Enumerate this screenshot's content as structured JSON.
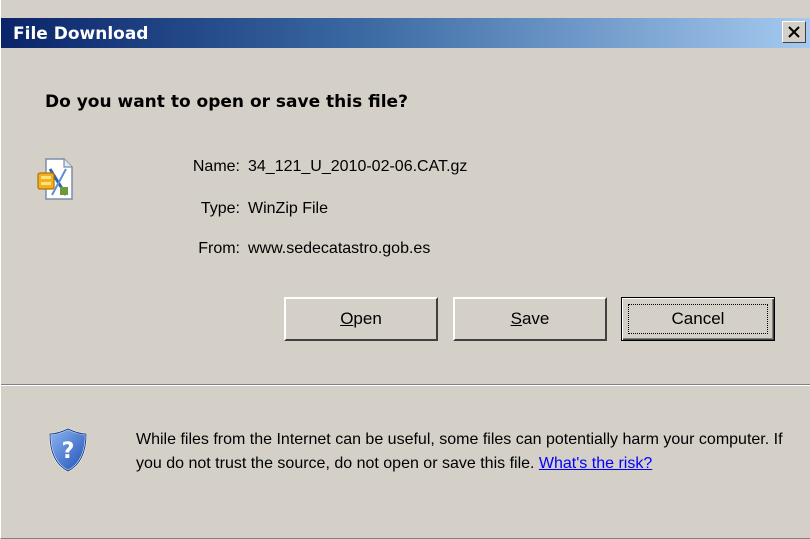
{
  "window": {
    "title": "File Download"
  },
  "dialog": {
    "question": "Do you want to open or save this file?",
    "file_icon": "winzip-file-icon",
    "info": {
      "name_label": "Name:",
      "name_value": "34_121_U_2010-02-06.CAT.gz",
      "type_label": "Type:",
      "type_value": "WinZip File",
      "from_label": "From:",
      "from_value": "www.sedecatastro.gob.es"
    },
    "buttons": {
      "open_prefix": "",
      "open_accel": "O",
      "open_rest": "pen",
      "save_prefix": "",
      "save_accel": "S",
      "save_rest": "ave",
      "cancel_label": "Cancel"
    }
  },
  "warning": {
    "icon": "security-shield-question-icon",
    "text": "While files from the Internet can be useful, some files can potentially harm your computer. If you do not trust the source, do not open or save this file. ",
    "link": "What's the risk?"
  },
  "colors": {
    "face": "#d4d0c8",
    "title_start": "#0a246a",
    "title_end": "#a6caf0",
    "link": "#0000ff"
  }
}
